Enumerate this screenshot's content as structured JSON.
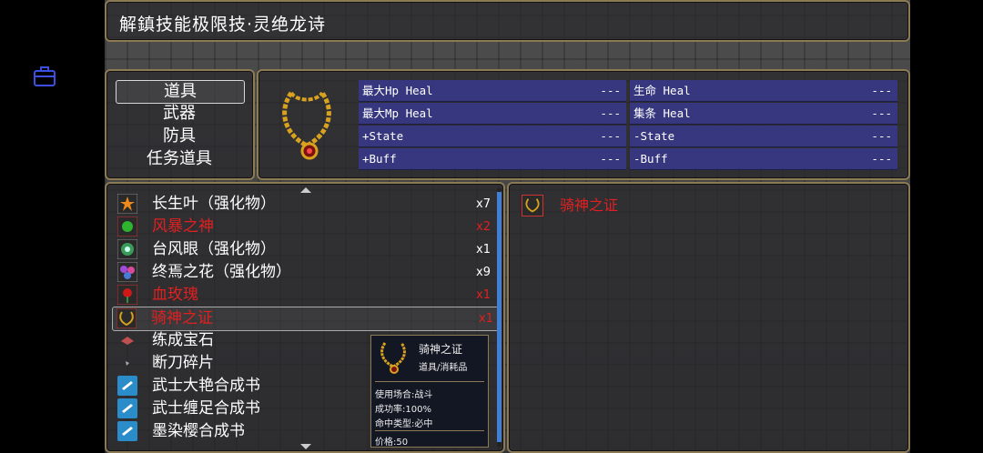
{
  "title": "解鎮技能极限技·灵绝龙诗",
  "categories": [
    {
      "label": "道具",
      "selected": true
    },
    {
      "label": "武器",
      "selected": false
    },
    {
      "label": "防具",
      "selected": false
    },
    {
      "label": "任务道具",
      "selected": false
    }
  ],
  "stats": {
    "left": [
      {
        "label": "最大Hp Heal",
        "value": "---"
      },
      {
        "label": "最大Mp Heal",
        "value": "---"
      },
      {
        "label": "+State",
        "value": "---"
      },
      {
        "label": "+Buff",
        "value": "---"
      }
    ],
    "right": [
      {
        "label": "生命 Heal",
        "value": "---"
      },
      {
        "label": "集条 Heal",
        "value": "---"
      },
      {
        "label": "-State",
        "value": "---"
      },
      {
        "label": "-Buff",
        "value": "---"
      }
    ]
  },
  "items": [
    {
      "name": "长生叶（强化物）",
      "count": "x7",
      "red": false,
      "icon": "orange-leaf-icon"
    },
    {
      "name": "风暴之神",
      "count": "x2",
      "red": true,
      "icon": "green-orb-icon"
    },
    {
      "name": "台风眼（强化物）",
      "count": "x1",
      "red": false,
      "icon": "eye-orb-icon"
    },
    {
      "name": "终焉之花（强化物）",
      "count": "x9",
      "red": false,
      "icon": "flower-icon"
    },
    {
      "name": "血玫瑰",
      "count": "x1",
      "red": true,
      "icon": "rose-icon"
    },
    {
      "name": "骑神之证",
      "count": "x1",
      "red": true,
      "icon": "necklace-icon"
    },
    {
      "name": "练成宝石",
      "count": "",
      "red": false,
      "icon": "gem-icon"
    },
    {
      "name": "断刀碎片",
      "count": "",
      "red": false,
      "icon": "shard-icon"
    },
    {
      "name": "武士大艳合成书",
      "count": "",
      "red": false,
      "icon": "book-icon"
    },
    {
      "name": "武士缠足合成书",
      "count": "",
      "red": false,
      "icon": "book-icon"
    },
    {
      "name": "墨染樱合成书",
      "count": "",
      "red": false,
      "icon": "book-icon"
    }
  ],
  "selected_item": {
    "name": "骑神之证",
    "type": "道具/消耗品",
    "usage": "使用场合:战斗",
    "success": "成功率:100%",
    "hit_type": "命中类型:必中",
    "price": "价格:50"
  },
  "colors": {
    "accent_red": "#e02020",
    "stat_bg": "#3a3a96",
    "border_gold": "#8c7a55",
    "scroll": "#3f7fd8"
  }
}
